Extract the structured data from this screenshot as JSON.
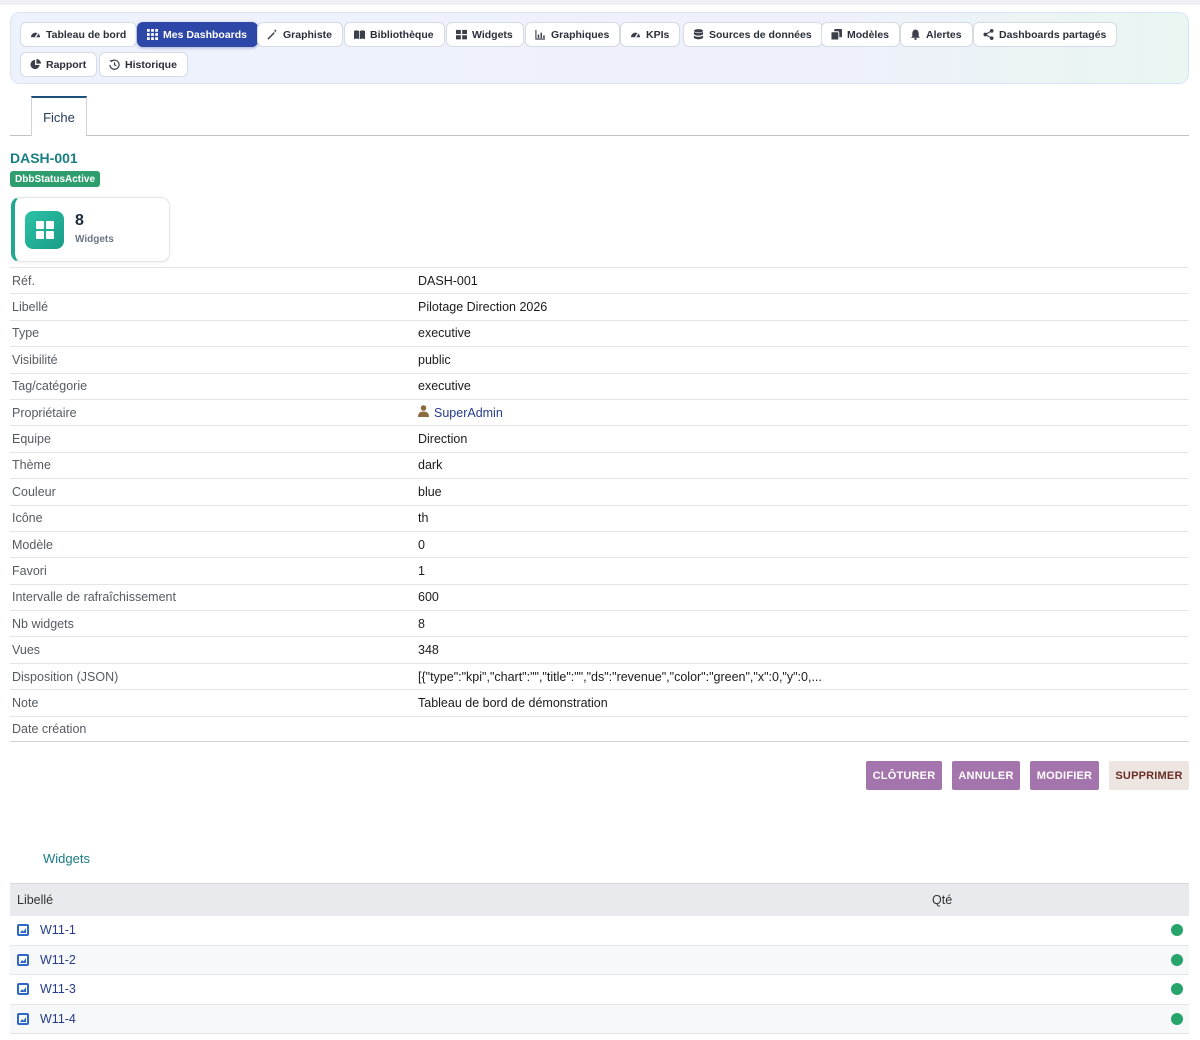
{
  "nav": {
    "items": [
      {
        "label": "Tableau de bord",
        "icon": "gauge-icon"
      },
      {
        "label": "Mes Dashboards",
        "icon": "grid-icon",
        "active": true
      },
      {
        "label": "Graphiste",
        "icon": "magic-wand-icon"
      },
      {
        "label": "Bibliothèque",
        "icon": "book-icon"
      },
      {
        "label": "Widgets",
        "icon": "widgets-icon"
      },
      {
        "label": "Graphiques",
        "icon": "bar-chart-icon"
      },
      {
        "label": "KPIs",
        "icon": "gauge-icon"
      },
      {
        "label": "Sources de données",
        "icon": "database-icon"
      },
      {
        "label": "Modèles",
        "icon": "copy-icon"
      },
      {
        "label": "Alertes",
        "icon": "bell-icon"
      },
      {
        "label": "Dashboards partagés",
        "icon": "share-icon"
      },
      {
        "label": "Rapport",
        "icon": "pie-chart-icon"
      },
      {
        "label": "Historique",
        "icon": "history-icon"
      }
    ]
  },
  "tabs": {
    "fiche": "Fiche"
  },
  "record": {
    "ref": "DASH-001",
    "status": "DbbStatusActive"
  },
  "stat": {
    "value": "8",
    "label": "Widgets",
    "icon": "widgets-icon"
  },
  "fields": [
    {
      "label": "Réf.",
      "value": "DASH-001"
    },
    {
      "label": "Libellé",
      "value": "Pilotage Direction 2026"
    },
    {
      "label": "Type",
      "value": "executive"
    },
    {
      "label": "Visibilité",
      "value": "public"
    },
    {
      "label": "Tag/catégorie",
      "value": "executive"
    },
    {
      "label": "Propriétaire",
      "value": "SuperAdmin",
      "link": true,
      "icon": "user-icon"
    },
    {
      "label": "Equipe",
      "value": "Direction"
    },
    {
      "label": "Thème",
      "value": "dark"
    },
    {
      "label": "Couleur",
      "value": "blue"
    },
    {
      "label": "Icône",
      "value": "th"
    },
    {
      "label": "Modèle",
      "value": "0"
    },
    {
      "label": "Favori",
      "value": "1"
    },
    {
      "label": "Intervalle de rafraîchissement",
      "value": "600"
    },
    {
      "label": "Nb widgets",
      "value": "8"
    },
    {
      "label": "Vues",
      "value": "348"
    },
    {
      "label": "Disposition (JSON)",
      "value": "[{\"type\":\"kpi\",\"chart\":\"\",\"title\":\"\",\"ds\":\"revenue\",\"color\":\"green\",\"x\":0,\"y\":0,..."
    },
    {
      "label": "Note",
      "value": "Tableau de bord de démonstration"
    },
    {
      "label": "Date création",
      "value": ""
    }
  ],
  "actions": {
    "close": "CLÔTURER",
    "cancel": "ANNULER",
    "modify": "MODIFIER",
    "delete": "SUPPRIMER"
  },
  "widgets_section": {
    "title": "Widgets",
    "columns": {
      "label": "Libellé",
      "qty": "Qté"
    },
    "rows": [
      {
        "label": "W11-1",
        "status_color": "#27a36c"
      },
      {
        "label": "W11-2",
        "status_color": "#27a36c"
      },
      {
        "label": "W11-3",
        "status_color": "#27a36c"
      },
      {
        "label": "W11-4",
        "status_color": "#27a36c"
      }
    ]
  },
  "colors": {
    "accent": "#2d47a8",
    "title": "#177e84",
    "status": "#2e9e6e",
    "action": "#a475ac"
  }
}
